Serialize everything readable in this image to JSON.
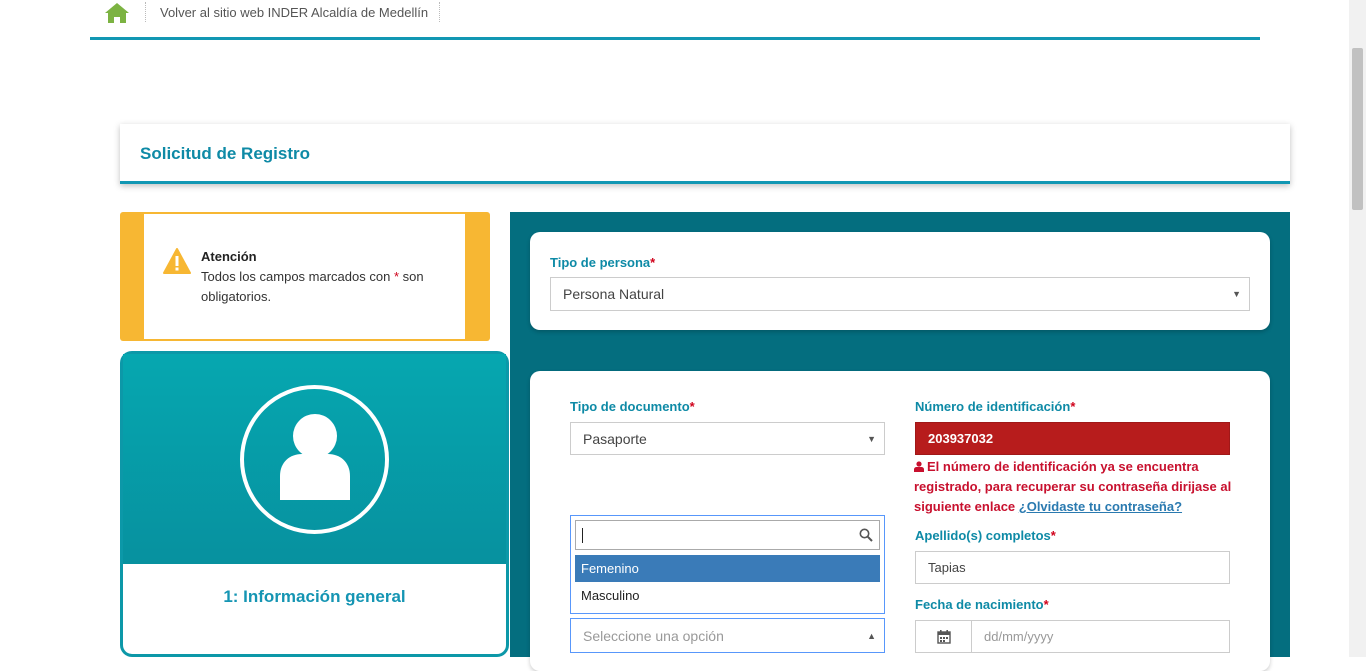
{
  "topbar": {
    "home_icon": "home-icon",
    "back_link": "Volver al sitio web INDER Alcaldía de Medellín"
  },
  "heading": {
    "title": "Solicitud de Registro"
  },
  "attention": {
    "icon": "warning-icon",
    "title": "Atención",
    "text_before": "Todos los campos marcados con ",
    "asterisk": "*",
    "text_after": " son obligatorios."
  },
  "step": {
    "icon": "user-avatar-icon",
    "label": "1: Información general"
  },
  "form": {
    "persona": {
      "label": "Tipo de persona",
      "value": "Persona Natural"
    },
    "documento": {
      "label": "Tipo de documento",
      "value": "Pasaporte"
    },
    "identificacion": {
      "label": "Número de identificación",
      "value": "203937032",
      "error": "El número de identificación ya se encuentra registrado, para recuperar su contraseña dirijase al siguiente enlace ",
      "error_link": "¿Olvidaste tu contraseña?"
    },
    "apellidos": {
      "label": "Apellido(s) completos",
      "value": "Tapias"
    },
    "fecha": {
      "label": "Fecha de nacimiento",
      "placeholder": "dd/mm/yyyy"
    },
    "sexo": {
      "placeholder": "Seleccione una opción",
      "search_value": "",
      "options": [
        "Femenino",
        "Masculino"
      ],
      "highlighted": "Femenino"
    },
    "required_mark": "*"
  },
  "colors": {
    "accent": "#0e8aa6",
    "warning": "#f7b733",
    "panel": "#046e7f",
    "error_bg": "#b71c1c",
    "home_green": "#7cb342"
  }
}
